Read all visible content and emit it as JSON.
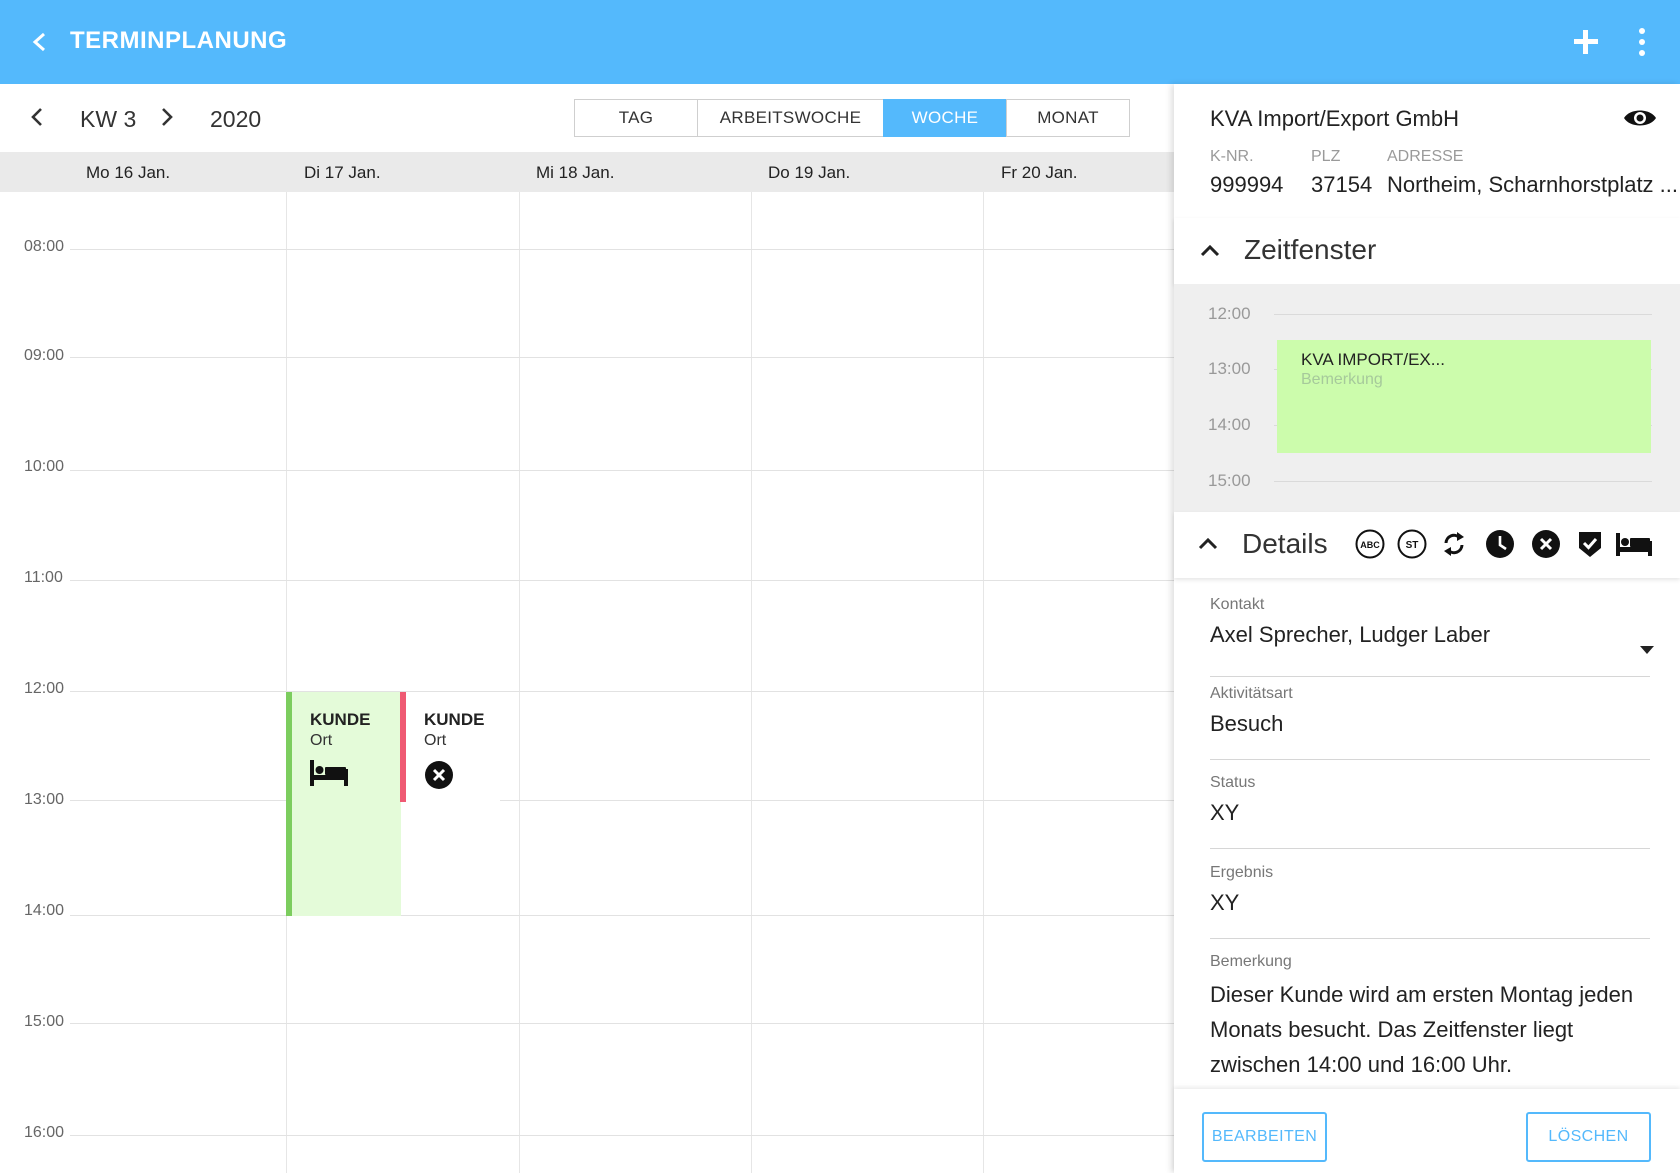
{
  "appbar": {
    "title": "TERMINPLANUNG",
    "back_icon": "back-arrow-icon",
    "add_icon": "plus-icon",
    "more_icon": "more-vert-icon",
    "color": "#54b9fc"
  },
  "weeknav": {
    "week": "KW 3",
    "year": "2020",
    "views": [
      {
        "label": "TAG",
        "active": false
      },
      {
        "label": "ARBEITSWOCHE",
        "active": false
      },
      {
        "label": "WOCHE",
        "active": true
      },
      {
        "label": "MONAT",
        "active": false
      }
    ]
  },
  "days": [
    {
      "label": "Mo  16 Jan."
    },
    {
      "label": "Di  17 Jan."
    },
    {
      "label": "Mi  18 Jan."
    },
    {
      "label": "Do  19 Jan."
    },
    {
      "label": "Fr  20 Jan."
    }
  ],
  "hours": [
    "08:00",
    "09:00",
    "10:00",
    "11:00",
    "12:00",
    "13:00",
    "14:00",
    "15:00",
    "16:00"
  ],
  "events": [
    {
      "title": "KUNDE",
      "subtitle": "Ort",
      "icon": "bed-icon",
      "color": "#7ccd5e"
    },
    {
      "title": "KUNDE",
      "subtitle": "Ort",
      "icon": "cancel-circle-icon",
      "color": "#ef5a73"
    }
  ],
  "panel": {
    "company": "KVA Import/Export GmbH",
    "visibility_icon": "eye-icon",
    "meta": [
      {
        "label": "K-NR.",
        "value": "999994"
      },
      {
        "label": "PLZ",
        "value": "37154"
      },
      {
        "label": "ADRESSE",
        "value": "Northeim, Scharnhorstplatz ..."
      }
    ],
    "zeitfenster": {
      "title": "Zeitfenster",
      "times": [
        "12:00",
        "13:00",
        "14:00",
        "15:00"
      ],
      "block_title": "KVA IMPORT/EX...",
      "block_subtitle": "Bemerkung"
    },
    "details": {
      "title": "Details",
      "icons": [
        "abc-icon",
        "st-icon",
        "sync-icon",
        "clock-icon",
        "cancel-circle-icon",
        "check-shield-icon",
        "bed-icon"
      ],
      "abc_text": "ABC",
      "st_text": "ST"
    },
    "fields": {
      "kontakt": {
        "label": "Kontakt",
        "value": "Axel Sprecher, Ludger Laber"
      },
      "aktivitaet": {
        "label": "Aktivitätsart",
        "value": "Besuch"
      },
      "status": {
        "label": "Status",
        "value": "XY"
      },
      "ergebnis": {
        "label": "Ergebnis",
        "value": "XY"
      },
      "bemerkung": {
        "label": "Bemerkung",
        "value": "Dieser Kunde wird am ersten Montag jeden Monats besucht. Das Zeitfenster liegt zwischen 14:00 und 16:00 Uhr."
      }
    },
    "buttons": {
      "edit": "BEARBEITEN",
      "delete": "LÖSCHEN"
    }
  }
}
